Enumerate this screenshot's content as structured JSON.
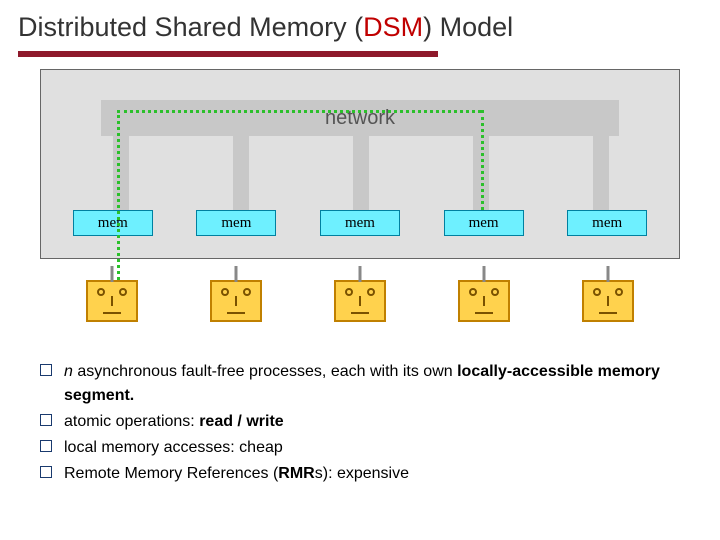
{
  "title": {
    "pre": "Distributed Shared Memory (",
    "dsm": "DSM",
    "post": ") Model"
  },
  "diagram": {
    "network_label": "network",
    "mem_label": "mem",
    "node_count": 5
  },
  "bullets": [
    {
      "plain1": "",
      "italic": "n",
      "plain2": " asynchronous fault-free processes, each with its own ",
      "bold": "locally-accessible memory segment.",
      "plain3": ""
    },
    {
      "plain1": "atomic operations: ",
      "italic": "",
      "plain2": "",
      "bold": "read / write",
      "plain3": ""
    },
    {
      "plain1": "local memory accesses: cheap",
      "italic": "",
      "plain2": "",
      "bold": "",
      "plain3": ""
    },
    {
      "plain1": "Remote Memory References (",
      "italic": "",
      "plain2": "",
      "bold": "RMR",
      "plain3": "s): expensive"
    }
  ]
}
